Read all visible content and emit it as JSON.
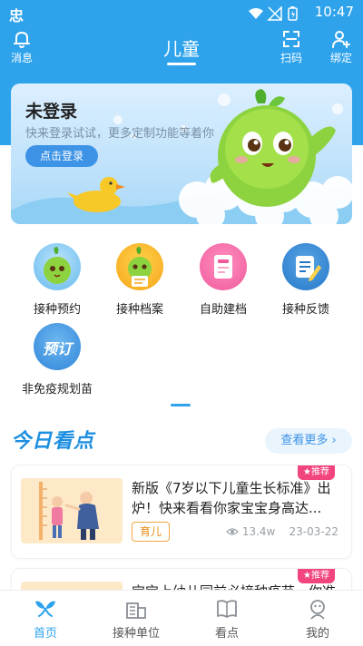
{
  "status_bar": {
    "time": "10:47",
    "app_glyph": "忠"
  },
  "header": {
    "title": "儿童",
    "left": {
      "label": "消息",
      "icon": "bell-icon"
    },
    "right": [
      {
        "label": "扫码",
        "icon": "scan-icon"
      },
      {
        "label": "绑定",
        "icon": "add-user-icon"
      }
    ]
  },
  "banner": {
    "title": "未登录",
    "subtitle": "快来登录试试，更多定制功能等着你",
    "button": "点击登录"
  },
  "menu": {
    "items": [
      {
        "label": "接种预约",
        "icon": "mascot-icon"
      },
      {
        "label": "接种档案",
        "icon": "mascot-icon"
      },
      {
        "label": "自助建档",
        "icon": "document-icon"
      },
      {
        "label": "接种反馈",
        "icon": "feedback-icon"
      },
      {
        "label": "非免疫规划苗",
        "icon": "reserve-icon",
        "badge_text": "预订"
      }
    ]
  },
  "news": {
    "section_title": "今日看点",
    "more": "查看更多 ›",
    "items": [
      {
        "title": "新版《7岁以下儿童生长标准》出炉！快来看看你家宝宝身高达...",
        "tag": "育儿",
        "views": "13.4w",
        "date": "23-03-22",
        "badge": "★推荐"
      },
      {
        "title": "宝宝上幼儿园前必接种疫苗，你准备...",
        "tag": "",
        "views": "",
        "date": "",
        "badge": "★推荐"
      }
    ]
  },
  "bottom_nav": {
    "items": [
      {
        "label": "首页",
        "icon": "home-icon",
        "active": true
      },
      {
        "label": "接种单位",
        "icon": "building-icon",
        "active": false
      },
      {
        "label": "看点",
        "icon": "book-icon",
        "active": false
      },
      {
        "label": "我的",
        "icon": "profile-icon",
        "active": false
      }
    ]
  },
  "colors": {
    "primary": "#2ea3ec",
    "accent_badge": "#f2457d",
    "tag": "#e88d14"
  }
}
